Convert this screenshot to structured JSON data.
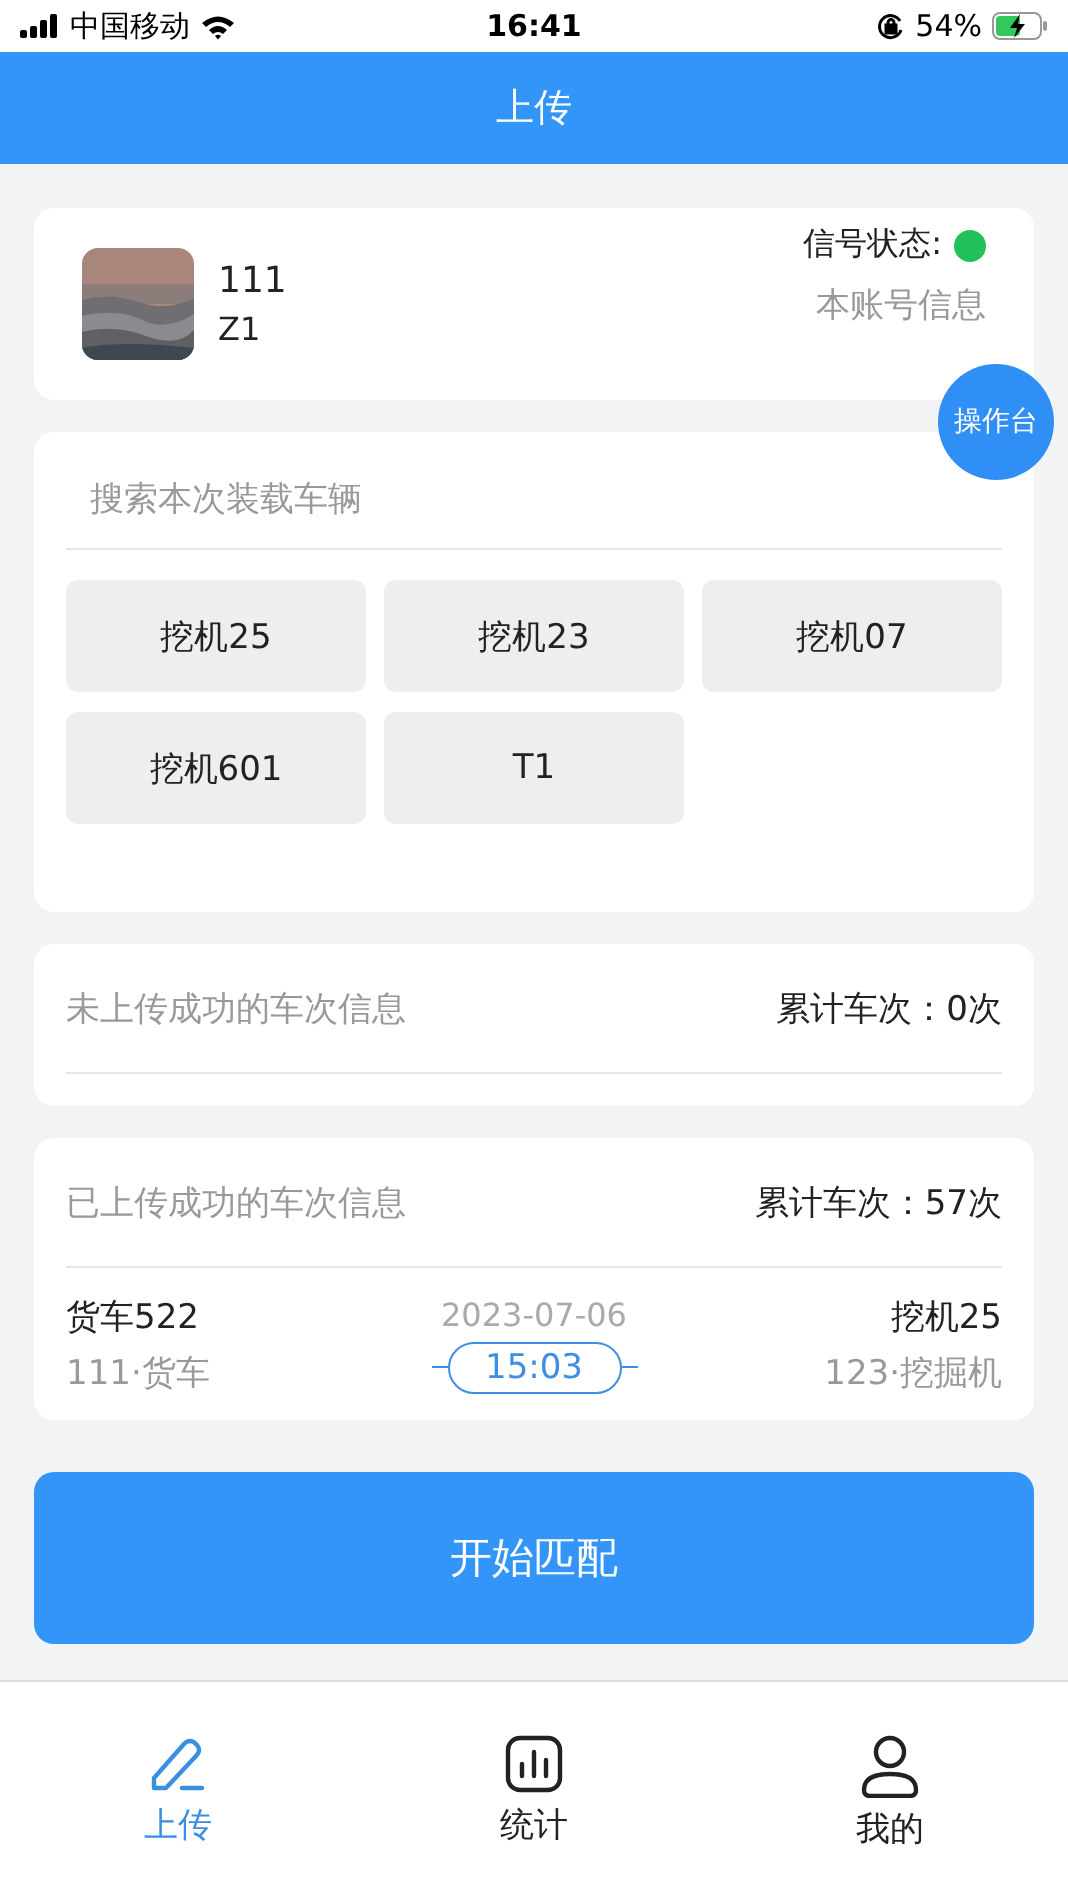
{
  "status_bar": {
    "carrier": "中国移动",
    "time": "16:41",
    "battery": "54%"
  },
  "header": {
    "title": "上传"
  },
  "account": {
    "name": "111",
    "sub": "Z1",
    "signal_label": "信号状态:",
    "signal_on": true,
    "link": "本账号信息"
  },
  "float_button": "操作台",
  "search": {
    "placeholder": "搜索本次装载车辆"
  },
  "vehicles": [
    "挖机25",
    "挖机23",
    "挖机07",
    "挖机601",
    "T1"
  ],
  "failed": {
    "title": "未上传成功的车次信息",
    "count": "累计车次：0次"
  },
  "uploaded": {
    "title": "已上传成功的车次信息",
    "count": "累计车次：57次",
    "records": [
      {
        "name": "货车522",
        "sub": "111·货车",
        "date": "2023-07-06",
        "time": "15:03",
        "target": "挖机25",
        "target_sub": "123·挖掘机"
      }
    ]
  },
  "match_button": "开始匹配",
  "tabs": [
    {
      "label": "上传",
      "kind": "pen",
      "selected": true
    },
    {
      "label": "统计",
      "kind": "chart",
      "selected": false
    },
    {
      "label": "我的",
      "kind": "user",
      "selected": false
    }
  ]
}
